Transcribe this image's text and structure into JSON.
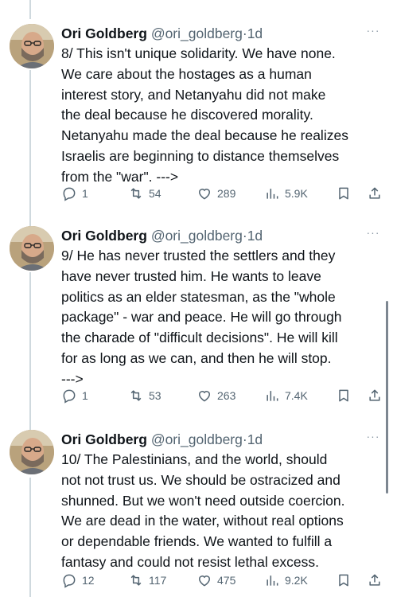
{
  "colors": {
    "text": "#0f1419",
    "secondary": "#536471",
    "thread_line": "#cfd9de"
  },
  "tweets": [
    {
      "author": "Ori Goldberg",
      "handle": "@ori_goldberg",
      "separator": "·",
      "time": "1d",
      "more": "···",
      "text": "8/ This isn't unique solidarity. We have none.\nWe care about the hostages as a human\ninterest story, and Netanyahu did not make\nthe deal because he discovered morality.\nNetanyahu made the deal because he realizes\nIsraelis are beginning to distance themselves\nfrom the \"war\". --->",
      "replies": "1",
      "retweets": "54",
      "likes": "289",
      "views": "5.9K"
    },
    {
      "author": "Ori Goldberg",
      "handle": "@ori_goldberg",
      "separator": "·",
      "time": "1d",
      "more": "···",
      "text": "9/ He has never trusted the settlers and they\nhave never trusted him. He wants to leave\npolitics as an elder statesman, as the \"whole\npackage\" - war and peace. He will go through\nthe charade of \"difficult decisions\". He will kill\nfor as long as we can, and then he will stop.\n--->",
      "replies": "1",
      "retweets": "53",
      "likes": "263",
      "views": "7.4K"
    },
    {
      "author": "Ori Goldberg",
      "handle": "@ori_goldberg",
      "separator": "·",
      "time": "1d",
      "more": "···",
      "text": "10/ The Palestinians, and the world, should\nnot not trust us. We should be ostracized and\nshunned. But we won't need outside coercion.\nWe are dead in the water, without real options\nor dependable friends. We wanted to fulfill a\nfantasy and could not resist lethal excess.",
      "replies": "12",
      "retweets": "117",
      "likes": "475",
      "views": "9.2K"
    }
  ]
}
